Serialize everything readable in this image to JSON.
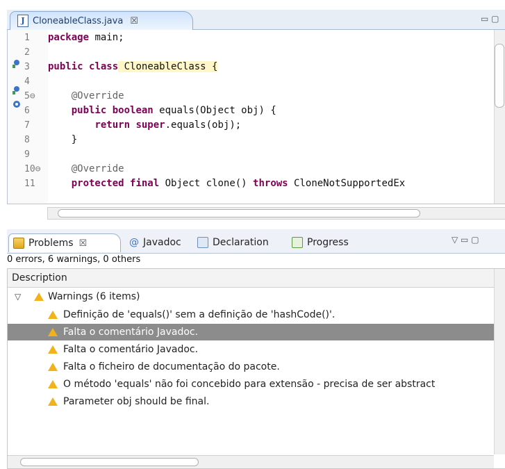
{
  "editor": {
    "tab_title": "CloneableClass.java",
    "tab_close_glyph": "☒",
    "window_controls": "▭ ▢",
    "lines": [
      {
        "num": "1",
        "segments": [
          {
            "t": "package",
            "c": "kw"
          },
          {
            "t": " main;",
            "c": ""
          }
        ]
      },
      {
        "num": "2",
        "segments": []
      },
      {
        "num": "3",
        "segments": [
          {
            "t": "public",
            "c": "kw"
          },
          {
            "t": " ",
            "c": ""
          },
          {
            "t": "class",
            "c": "kw"
          },
          {
            "t": " CloneableClass {",
            "c": "hl"
          }
        ]
      },
      {
        "num": "4",
        "segments": []
      },
      {
        "num": "5⊖",
        "segments": [
          {
            "t": "    @Override",
            "c": "ann"
          }
        ]
      },
      {
        "num": "6",
        "segments": [
          {
            "t": "    ",
            "c": ""
          },
          {
            "t": "public",
            "c": "kw"
          },
          {
            "t": " ",
            "c": ""
          },
          {
            "t": "boolean",
            "c": "kw"
          },
          {
            "t": " equals(Object obj) {",
            "c": ""
          }
        ]
      },
      {
        "num": "7",
        "segments": [
          {
            "t": "        ",
            "c": ""
          },
          {
            "t": "return",
            "c": "kw"
          },
          {
            "t": " ",
            "c": ""
          },
          {
            "t": "super",
            "c": "kw"
          },
          {
            "t": ".equals(obj);",
            "c": ""
          }
        ]
      },
      {
        "num": "8",
        "segments": [
          {
            "t": "    }",
            "c": ""
          }
        ]
      },
      {
        "num": "9",
        "segments": []
      },
      {
        "num": "10⊖",
        "segments": [
          {
            "t": "    @Override",
            "c": "ann"
          }
        ]
      },
      {
        "num": "11",
        "segments": [
          {
            "t": "    ",
            "c": ""
          },
          {
            "t": "protected",
            "c": "kw"
          },
          {
            "t": " ",
            "c": ""
          },
          {
            "t": "final",
            "c": "kw"
          },
          {
            "t": " Object clone() ",
            "c": ""
          },
          {
            "t": "throws",
            "c": "kw"
          },
          {
            "t": " CloneNotSupportedEx",
            "c": ""
          }
        ]
      }
    ]
  },
  "views": {
    "tabs": [
      {
        "label": "Problems",
        "icon": "problems-icon",
        "active": true,
        "close": "☒"
      },
      {
        "label": "Javadoc",
        "icon": "javadoc-icon",
        "active": false
      },
      {
        "label": "Declaration",
        "icon": "declaration-icon",
        "active": false
      },
      {
        "label": "Progress",
        "icon": "progress-icon",
        "active": false
      }
    ],
    "menu_controls": "▽ ▭ ▢"
  },
  "problems": {
    "summary": "0 errors, 6 warnings, 0 others",
    "column_header": "Description",
    "group_label": "Warnings (6 items)",
    "items": [
      "Definição de 'equals()' sem a definição de 'hashCode()'.",
      "Falta o comentário Javadoc.",
      "Falta o comentário Javadoc.",
      "Falta o ficheiro de documentação do pacote.",
      "O método 'equals' não foi concebido para extensão - precisa de ser abstract",
      "Parameter obj should be final."
    ],
    "selected_index": 1
  },
  "colors": {
    "keyword": "#7f0055",
    "annotation": "#646464",
    "warning": "#f2b21a",
    "selection": "#8c8c8c"
  }
}
